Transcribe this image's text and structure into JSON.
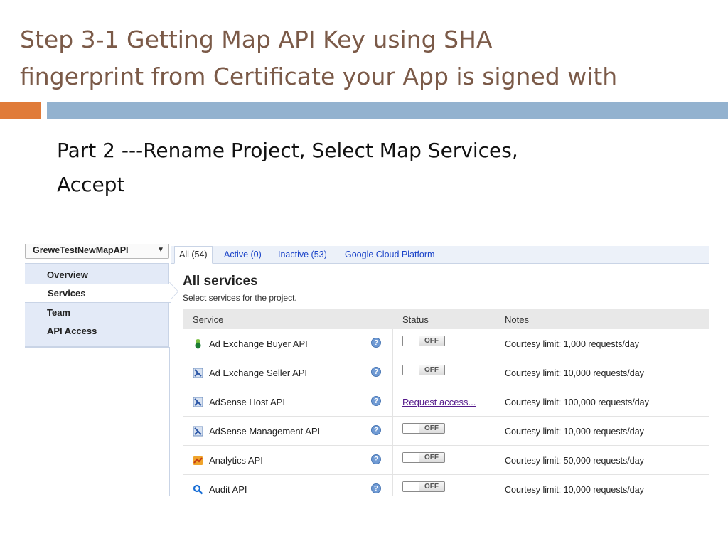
{
  "slide": {
    "title_lines": [
      "Step 3-1 Getting Map API Key using SHA",
      "fingerprint from Certificate your App is signed with"
    ],
    "bullet_lines": [
      "Part 2 ---Rename Project,  Select Map Services,",
      "Accept"
    ],
    "colors": {
      "title": "#7b5a48",
      "accent_orange": "#e07b39",
      "accent_blue": "#93b2cf"
    }
  },
  "console": {
    "project_select": {
      "value": "GreweTestNewMapAPI",
      "arrow": "▼"
    },
    "nav": {
      "items": [
        {
          "label": "Overview",
          "active": false
        },
        {
          "label": "Services",
          "active": true
        },
        {
          "label": "Team",
          "active": false
        },
        {
          "label": "API Access",
          "active": false
        }
      ]
    },
    "tabs": [
      {
        "label": "All (54)",
        "active": true
      },
      {
        "label": "Active (0)",
        "active": false
      },
      {
        "label": "Inactive (53)",
        "active": false
      },
      {
        "label": "Google Cloud Platform",
        "active": false
      }
    ],
    "heading": "All services",
    "subheading": "Select services for the project.",
    "table": {
      "headers": {
        "service": "Service",
        "status": "Status",
        "notes": "Notes"
      },
      "rows": [
        {
          "service": "Ad Exchange Buyer API",
          "icon": "ad-exchange-buyer-icon",
          "status": "OFF",
          "status_type": "toggle",
          "notes": "Courtesy limit: 1,000 requests/day"
        },
        {
          "service": "Ad Exchange Seller API",
          "icon": "ad-exchange-seller-icon",
          "status": "OFF",
          "status_type": "toggle",
          "notes": "Courtesy limit: 10,000 requests/day"
        },
        {
          "service": "AdSense Host API",
          "icon": "adsense-icon",
          "status": "Request access...",
          "status_type": "link",
          "notes": "Courtesy limit: 100,000 requests/day"
        },
        {
          "service": "AdSense Management API",
          "icon": "adsense-icon",
          "status": "OFF",
          "status_type": "toggle",
          "notes": "Courtesy limit: 10,000 requests/day"
        },
        {
          "service": "Analytics API",
          "icon": "analytics-icon",
          "status": "OFF",
          "status_type": "toggle",
          "notes": "Courtesy limit: 50,000 requests/day"
        },
        {
          "service": "Audit API",
          "icon": "magnifier-icon",
          "status": "OFF",
          "status_type": "toggle",
          "notes": "Courtesy limit: 10,000 requests/day"
        }
      ],
      "help_glyph": "?"
    }
  }
}
